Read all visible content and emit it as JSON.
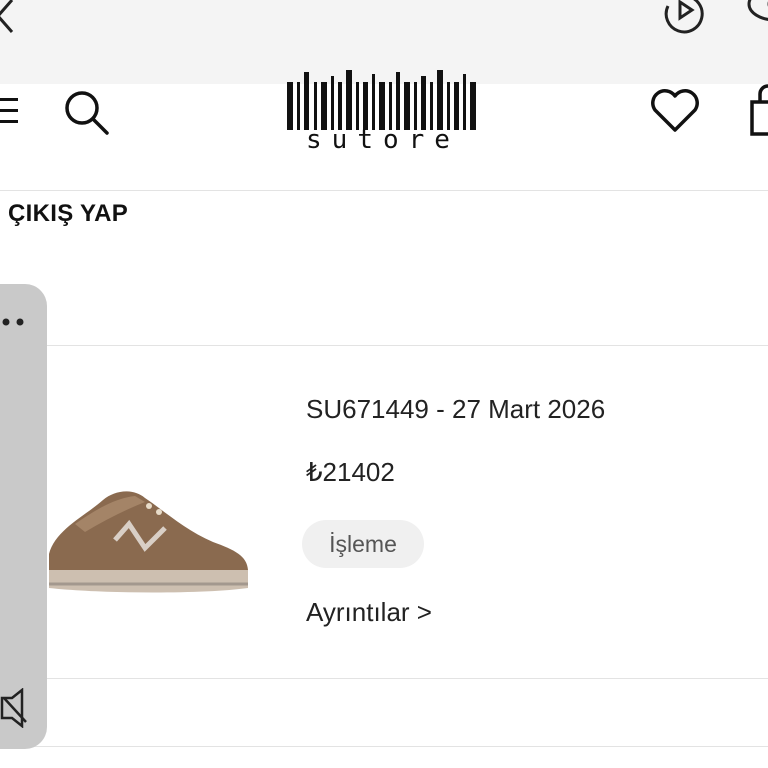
{
  "logo": {
    "brand_text": "sutore"
  },
  "nav": {
    "logout_label": "ÇIKIŞ YAP"
  },
  "order": {
    "id_date": "SU671449 - 27 Mart 2026",
    "price": "₺21402",
    "status": "İşleme",
    "details_link": "Ayrıntılar >"
  },
  "icons": {
    "back": "back-chevron-icon",
    "top_right_1": "rotate-play-icon",
    "top_right_2": "eye-icon",
    "menu": "hamburger-menu-icon",
    "search": "search-icon",
    "wishlist": "heart-icon",
    "cart": "shopping-bag-icon",
    "panel_more": "more-dots-icon",
    "panel_collapse": "collapse-icon"
  },
  "colors": {
    "topbar": "#f4f4f4",
    "status_bg": "#f0f0f0",
    "side_panel": "#c9c9c9",
    "shoe": "#8a6a4f"
  }
}
